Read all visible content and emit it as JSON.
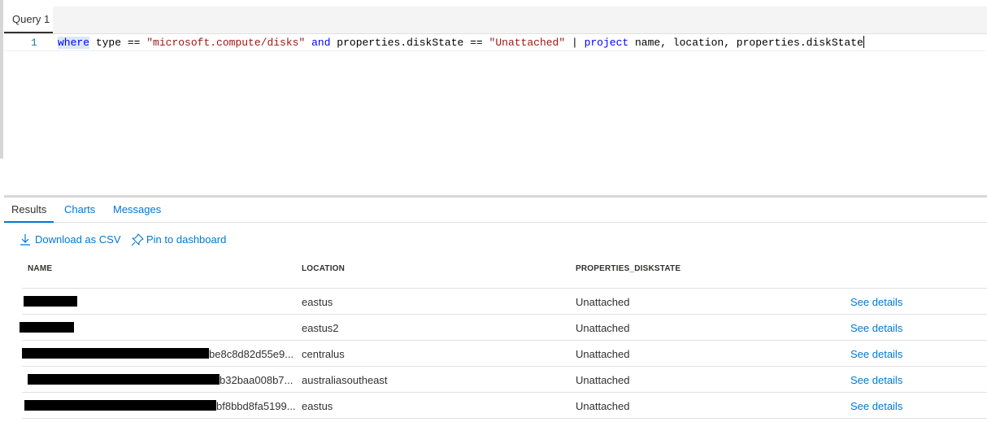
{
  "query_tab": {
    "label": "Query 1"
  },
  "editor": {
    "line_number": "1",
    "code": {
      "kw_where": "where",
      "t1": " type == ",
      "s1": "\"microsoft.compute/disks\"",
      "t2": " ",
      "kw_and": "and",
      "t3": " properties.diskState == ",
      "s2": "\"Unattached\"",
      "t4": " | ",
      "kw_project": "project",
      "t5": " name, location, properties.diskState"
    }
  },
  "result_tabs": {
    "results": "Results",
    "charts": "Charts",
    "messages": "Messages"
  },
  "toolbar": {
    "download_csv": "Download as CSV",
    "pin_dashboard": "Pin to dashboard"
  },
  "table": {
    "headers": {
      "name": "NAME",
      "location": "LOCATION",
      "diskstate": "PROPERTIES_DISKSTATE"
    },
    "rows": [
      {
        "name": "",
        "location": "eastus",
        "state": "Unattached",
        "details": "See details"
      },
      {
        "name": "",
        "location": "eastus2",
        "state": "Unattached",
        "details": "See details"
      },
      {
        "name": "be8c8d82d55e9...",
        "location": "centralus",
        "state": "Unattached",
        "details": "See details"
      },
      {
        "name": "b32baa008b7...",
        "location": "australiasoutheast",
        "state": "Unattached",
        "details": "See details"
      },
      {
        "name": "bf8bbd8fa5199...",
        "location": "eastus",
        "state": "Unattached",
        "details": "See details"
      }
    ]
  }
}
